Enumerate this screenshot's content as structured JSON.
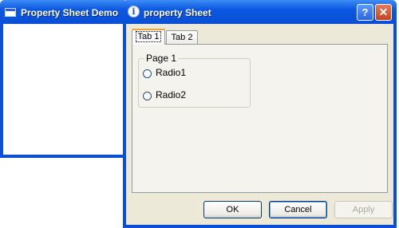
{
  "background_window": {
    "title": "Property Sheet Demo"
  },
  "dialog": {
    "title": "property Sheet",
    "help_label": "?",
    "close_label": "✕",
    "info_icon_glyph": "i"
  },
  "tabs": [
    {
      "label": "Tab 1",
      "selected": true
    },
    {
      "label": "Tab 2",
      "selected": false
    }
  ],
  "page": {
    "group_label": "Page 1",
    "radios": [
      {
        "label": "Radio1",
        "checked": false
      },
      {
        "label": "Radio2",
        "checked": false
      }
    ]
  },
  "buttons": {
    "ok": "OK",
    "cancel": "Cancel",
    "apply": "Apply",
    "apply_enabled": false
  },
  "colors": {
    "titlebar": "#0a4fd6",
    "dialog_face": "#ece9d8",
    "close_red": "#c7431f"
  }
}
